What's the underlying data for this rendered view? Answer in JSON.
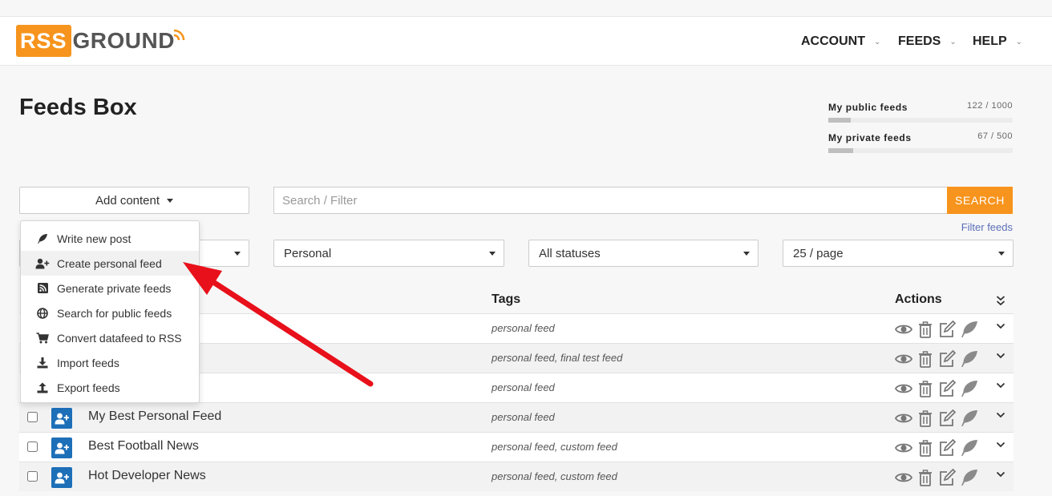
{
  "brand": {
    "logo_rss": "RSS",
    "logo_ground": "GROUND"
  },
  "nav": {
    "account": "ACCOUNT",
    "feeds": "FEEDS",
    "help": "HELP"
  },
  "page": {
    "title": "Feeds Box"
  },
  "stats": {
    "public": {
      "label": "My public feeds",
      "count": "122 / 1000",
      "used_fraction": 0.122
    },
    "private": {
      "label": "My private feeds",
      "count": "67 / 500",
      "used_fraction": 0.134
    }
  },
  "toolbar": {
    "add_content": "Add content",
    "search_placeholder": "Search / Filter",
    "search_button": "SEARCH",
    "filter_feeds": "Filter feeds"
  },
  "filters": {
    "type": "Personal",
    "status": "All statuses",
    "per_page": "25 / page"
  },
  "table": {
    "tags_header": "Tags",
    "actions_header": "Actions"
  },
  "rows": [
    {
      "name": "",
      "tags": "personal feed"
    },
    {
      "name": "",
      "tags": "personal feed, final test feed"
    },
    {
      "name": "",
      "tags": "personal feed"
    },
    {
      "name": "My Best Personal Feed",
      "tags": "personal feed"
    },
    {
      "name": "Best Football News",
      "tags": "personal feed, custom feed"
    },
    {
      "name": "Hot Developer News",
      "tags": "personal feed, custom feed"
    }
  ],
  "menu": {
    "items": [
      {
        "label": "Write new post",
        "icon": "feather-icon"
      },
      {
        "label": "Create personal feed",
        "icon": "user-plus-icon"
      },
      {
        "label": "Generate private feeds",
        "icon": "rss-square-icon"
      },
      {
        "label": "Search for public feeds",
        "icon": "globe-icon"
      },
      {
        "label": "Convert datafeed to RSS",
        "icon": "cart-icon"
      },
      {
        "label": "Import feeds",
        "icon": "download-icon"
      },
      {
        "label": "Export feeds",
        "icon": "upload-icon"
      }
    ]
  },
  "colors": {
    "accent": "#f7941d",
    "row_icon": "#1d6fb8",
    "annotation_arrow": "#e8101a",
    "link": "#5a6fb8"
  }
}
